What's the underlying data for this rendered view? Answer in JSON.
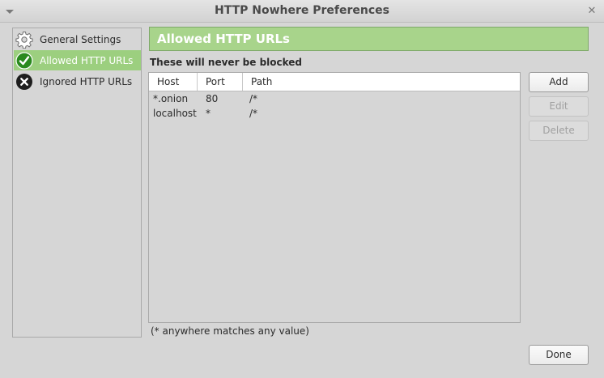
{
  "window": {
    "title": "HTTP Nowhere Preferences"
  },
  "sidebar": {
    "items": [
      {
        "label": "General Settings",
        "icon": "gear-icon",
        "selected": false
      },
      {
        "label": "Allowed HTTP URLs",
        "icon": "check-circle-icon",
        "selected": true
      },
      {
        "label": "Ignored HTTP URLs",
        "icon": "x-circle-icon",
        "selected": false
      }
    ]
  },
  "main": {
    "header": "Allowed HTTP URLs",
    "subheading": "These will never be blocked",
    "table": {
      "columns": [
        "Host",
        "Port",
        "Path"
      ],
      "rows": [
        [
          "*.onion",
          "80",
          "/*"
        ],
        [
          "localhost",
          "*",
          "/*"
        ]
      ]
    },
    "footnote": "(* anywhere matches any value)"
  },
  "buttons": {
    "add": "Add",
    "edit": "Edit",
    "delete": "Delete",
    "done": "Done"
  },
  "colors": {
    "accent_green": "#a8d48b",
    "selection_green": "#9ccf7f",
    "window_bg": "#d6d6d6"
  }
}
